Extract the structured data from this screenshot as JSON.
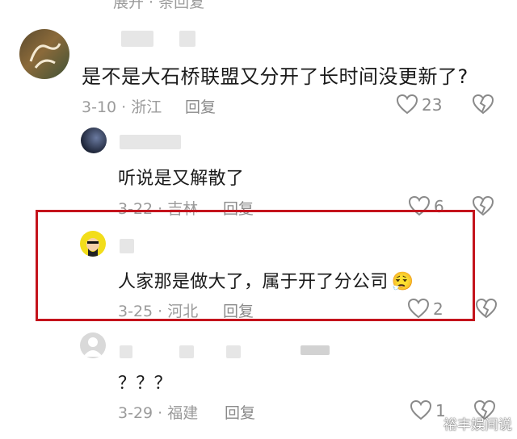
{
  "top_partial": {
    "text": "展开 · 条回复"
  },
  "comments": [
    {
      "text": "是不是大石桥联盟又分开了长时间没更新了?",
      "date": "3-10",
      "location": "浙江",
      "reply_label": "回复",
      "likes": "23"
    },
    {
      "text": "听说是又解散了",
      "date": "3-22",
      "location": "吉林",
      "reply_label": "回复",
      "likes": "6"
    },
    {
      "text": "人家那是做大了，属于开了分公司",
      "emoji": "😮‍💨",
      "date": "3-25",
      "location": "河北",
      "reply_label": "回复",
      "likes": "2"
    },
    {
      "text": "？？？",
      "date": "3-29",
      "location": "福建",
      "reply_label": "回复",
      "likes": "1"
    }
  ],
  "watermark": "裕丰娱间说",
  "icons": {
    "like": "heart-outline-icon",
    "dislike": "broken-heart-icon"
  },
  "colors": {
    "highlight_border": "#c4131c",
    "meta_text": "#9b9b9b"
  }
}
